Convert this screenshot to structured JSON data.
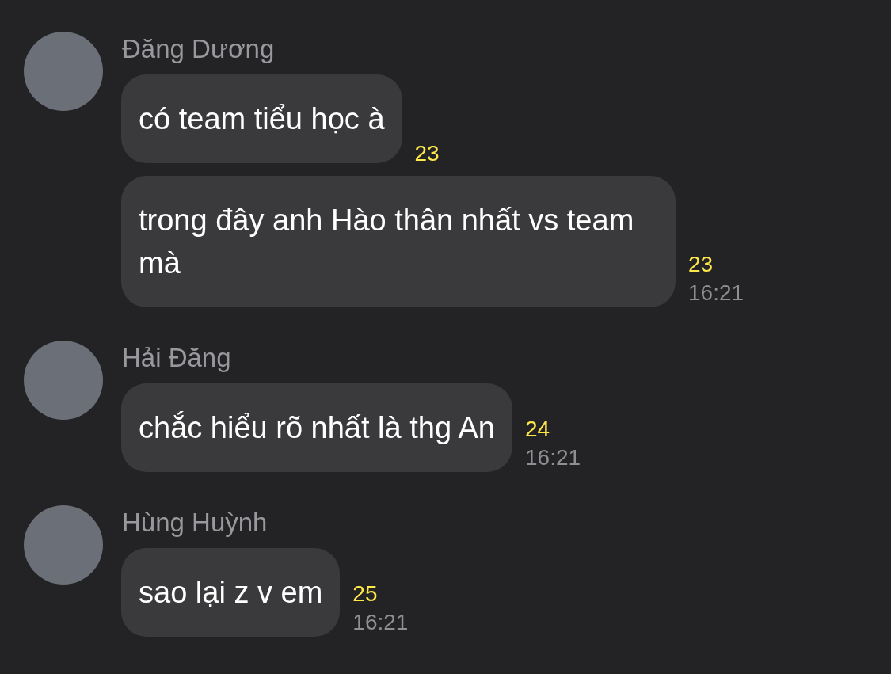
{
  "groups": [
    {
      "sender": "Đăng Dương",
      "messages": [
        {
          "text": "có team tiểu học à",
          "count": "23"
        },
        {
          "text": "trong đây anh Hào thân nhất vs team mà",
          "count": "23",
          "time": "16:21"
        }
      ]
    },
    {
      "sender": "Hải Đăng",
      "messages": [
        {
          "text": "chắc hiểu rõ nhất là thg An",
          "count": "24",
          "time": "16:21"
        }
      ]
    },
    {
      "sender": "Hùng Huỳnh",
      "messages": [
        {
          "text": "sao lại z v em",
          "count": "25",
          "time": "16:21"
        }
      ]
    }
  ]
}
